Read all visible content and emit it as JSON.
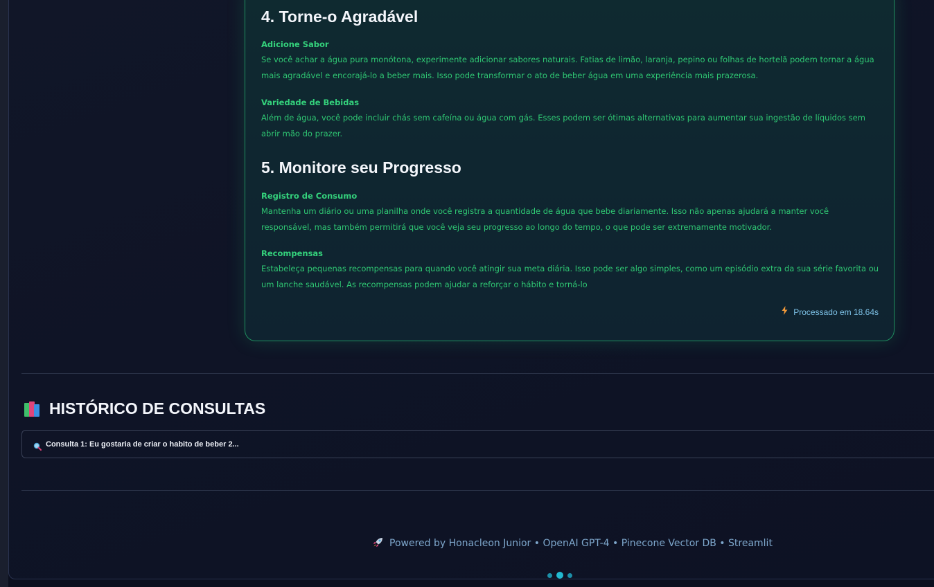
{
  "answer": {
    "sections": [
      {
        "title": "4. Torne-o Agradável",
        "items": [
          {
            "subtitle": "Adicione Sabor",
            "text": "Se você achar a água pura monótona, experimente adicionar sabores naturais. Fatias de limão, laranja, pepino ou folhas de hortelã podem tornar a água mais agradável e encorajá-lo a beber mais. Isso pode transformar o ato de beber água em uma experiência mais prazerosa."
          },
          {
            "subtitle": "Variedade de Bebidas",
            "text": "Além de água, você pode incluir chás sem cafeína ou água com gás. Esses podem ser ótimas alternativas para aumentar sua ingestão de líquidos sem abrir mão do prazer."
          }
        ]
      },
      {
        "title": "5. Monitore seu Progresso",
        "items": [
          {
            "subtitle": "Registro de Consumo",
            "text": "Mantenha um diário ou uma planilha onde você registra a quantidade de água que bebe diariamente. Isso não apenas ajudará a manter você responsável, mas também permitirá que você veja seu progresso ao longo do tempo, o que pode ser extremamente motivador."
          },
          {
            "subtitle": "Recompensas",
            "text": "Estabeleça pequenas recompensas para quando você atingir sua meta diária. Isso pode ser algo simples, como um episódio extra da sua série favorita ou um lanche saudável. As recompensas podem ajudar a reforçar o hábito e torná-lo"
          }
        ]
      }
    ],
    "processed_label": "Processado em 18.64s",
    "processed_icon": "lightning-bolt-icon"
  },
  "history": {
    "icon": "books-icon",
    "title": "HISTÓRICO DE CONSULTAS",
    "items": [
      {
        "icon": "magnifier-icon",
        "label": "Consulta 1: Eu gostaria de criar o habito de beber 2..."
      }
    ]
  },
  "footer": {
    "icon": "rocket-icon",
    "text": "Powered by Honacleon Junior • OpenAI GPT-4 • Pinecone Vector DB • Streamlit"
  },
  "colors": {
    "accent_green": "#34d27c",
    "card_border": "#1f8f5f",
    "footer_text": "#7ea7cc",
    "processed_text": "#7ec3e8",
    "dot_active": "#22b9d0"
  }
}
